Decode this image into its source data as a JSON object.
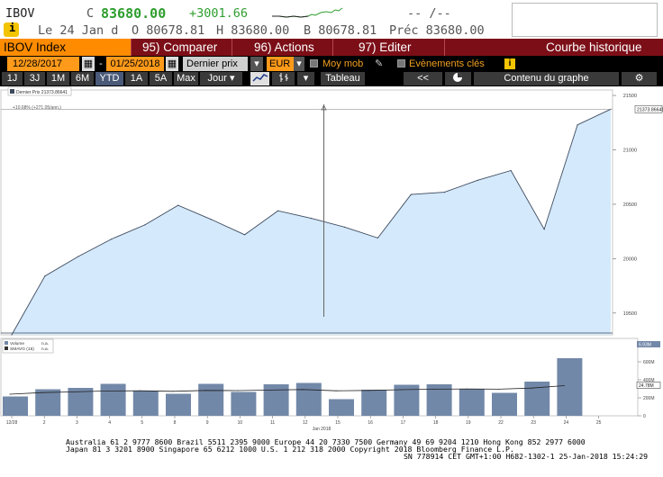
{
  "quote": {
    "ticker": "IBOV",
    "c_label": "C",
    "last": "83680.00",
    "change": "+3001.66",
    "dash": "-- /--",
    "date_line": "Le 24 Jan d",
    "open": "O 80678.81",
    "high": "H 83680.00",
    "low": "B 80678.81",
    "prev": "Préc 83680.00"
  },
  "menu": {
    "index": "IBOV Index",
    "compare": "95) Comparer",
    "actions": "96) Actions",
    "edit": "97) Editer",
    "title": "Courbe historique"
  },
  "controls": {
    "start_date": "12/28/2017",
    "separator": "-",
    "end_date": "01/25/2018",
    "price_type": "Dernier prix",
    "currency": "EUR",
    "moving_avg": "Moy mob",
    "events": "Evènements clés"
  },
  "periods": [
    "1J",
    "3J",
    "1M",
    "6M",
    "YTD",
    "1A",
    "5A",
    "Max"
  ],
  "selected_period": "YTD",
  "frequency": "Jour",
  "table_label": "Tableau",
  "prev_label": "<<",
  "content_label": "Contenu du graphe",
  "icons": [
    "calendar-icon",
    "dropdown-icon",
    "pencil-icon",
    "info-icon",
    "line-chart-icon",
    "bar-chart-icon",
    "gear-icon",
    "chevron-down-icon"
  ],
  "colors": {
    "accent_orange": "#ff9a1a",
    "menu_red": "#7c0e17",
    "area_fill": "#d4e9fb",
    "volume_bar": "#7288a8",
    "up_green": "#2e9e2e"
  },
  "chart_data": [
    {
      "type": "area",
      "legend": "Dernier Prix 21373.86641",
      "annotation": "+10.68% (+271.05/ann.)",
      "last_value_label": "21373.86641",
      "x": [
        "12/28",
        "01/02",
        "01/03",
        "01/04",
        "01/05",
        "01/08",
        "01/09",
        "01/10",
        "01/11",
        "01/12",
        "01/15",
        "01/16",
        "01/17",
        "01/18",
        "01/19",
        "01/22",
        "01/23",
        "01/24"
      ],
      "values": [
        19300,
        19840,
        20020,
        20180,
        20310,
        20490,
        20360,
        20220,
        20440,
        20370,
        20290,
        20190,
        20590,
        20610,
        20720,
        20810,
        20270,
        21230,
        21373.87
      ],
      "value_dates": [
        "12/27",
        "12/28",
        "01/02",
        "01/03",
        "01/04",
        "01/05",
        "01/08",
        "01/09",
        "01/10",
        "01/11",
        "01/12",
        "01/15",
        "01/16",
        "01/17",
        "01/18",
        "01/19",
        "01/22",
        "01/23",
        "01/24"
      ],
      "y_ticks": [
        19500,
        20000,
        20500,
        21000,
        21500
      ],
      "ylim": [
        19300,
        21550
      ]
    },
    {
      "type": "bar",
      "legend": [
        "Volume",
        "SMAVG (15)"
      ],
      "legend_values": [
        "n.a.",
        "n.a."
      ],
      "x_labels": [
        "12/28",
        "2",
        "3",
        "4",
        "5",
        "8",
        "9",
        "10",
        "11",
        "12",
        "15",
        "16",
        "17",
        "18",
        "19",
        "22",
        "23",
        "24",
        "25"
      ],
      "x_caption": "Jan 2018",
      "values": [
        215,
        295,
        310,
        355,
        275,
        245,
        355,
        265,
        350,
        365,
        185,
        290,
        345,
        350,
        300,
        255,
        380,
        640
      ],
      "smavg": [
        240,
        258,
        266,
        276,
        278,
        272,
        282,
        280,
        286,
        292,
        278,
        282,
        290,
        296,
        298,
        296,
        308,
        335
      ],
      "y_ticks": [
        "0",
        "200M",
        "400M",
        "600M",
        "800M"
      ],
      "y_tick_values": [
        0,
        200,
        400,
        600,
        800
      ],
      "ylim": [
        0,
        800
      ],
      "last_labels": [
        "6.93M",
        "24.78M"
      ]
    }
  ],
  "footer": {
    "line1": "Australia 61 2 9777 8600 Brazil 5511 2395 9000 Europe 44 20 7330 7500 Germany 49 69 9204 1210 Hong Kong 852 2977 6000",
    "line2": "Japan 81 3 3201 8900        Singapore 65 6212 1000        U.S. 1 212 318 2000        Copyright 2018 Bloomberg Finance L.P.",
    "line3": "SN 778914 CET  GMT+1:00 H682-1302-1 25-Jan-2018 15:24:29"
  }
}
